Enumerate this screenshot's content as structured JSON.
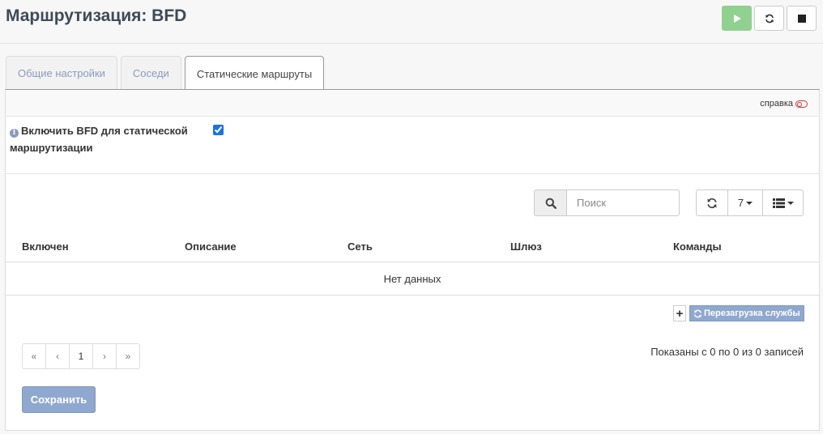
{
  "page": {
    "title": "Маршрутизация: BFD"
  },
  "service_buttons": [
    {
      "name": "start-service-button",
      "icon": "play-icon"
    },
    {
      "name": "restart-service-button",
      "icon": "refresh-icon"
    },
    {
      "name": "stop-service-button",
      "icon": "stop-icon"
    }
  ],
  "tabs": [
    {
      "label": "Общие настройки",
      "active": false
    },
    {
      "label": "Соседи",
      "active": false
    },
    {
      "label": "Статические маршруты",
      "active": true
    }
  ],
  "help": {
    "label": "справка",
    "enabled": false
  },
  "setting": {
    "label": "Включить BFD для статической маршрутизации",
    "checked": true
  },
  "grid": {
    "search_placeholder": "Поиск",
    "rows_per_page": "7",
    "columns": [
      "Включен",
      "Описание",
      "Сеть",
      "Шлюз",
      "Команды"
    ],
    "empty_text": "Нет данных",
    "add_symbol": "+",
    "reload_label": "Перезагрузка службы",
    "pager": [
      "«",
      "‹",
      "1",
      "›",
      "»"
    ],
    "records_info": "Показаны с 0 по 0 из 0 записей"
  },
  "save_label": "Сохранить",
  "colors": {
    "accent": "#8fa8cf",
    "start_green": "#8fd18f",
    "title": "#3e4a59"
  }
}
